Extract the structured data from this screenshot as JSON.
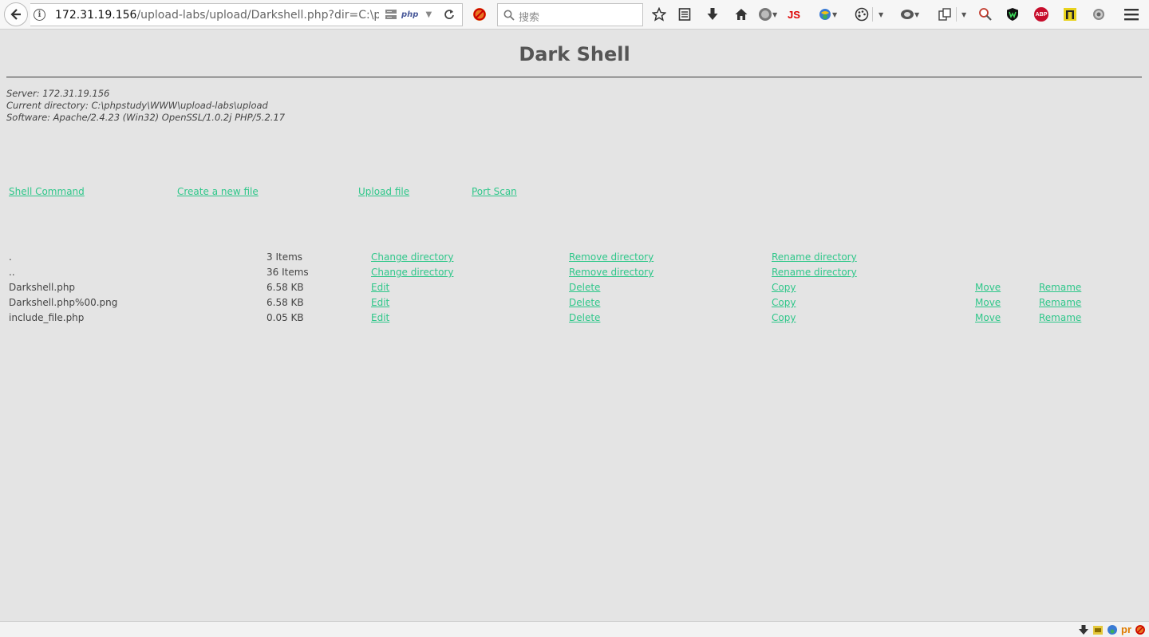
{
  "browser": {
    "url_host": "172.31.19.156",
    "url_path": "/upload-labs/upload/Darkshell.php?dir=C:\\phpstudy\\WWW\\upload-labs\\upload",
    "php_badge": "php",
    "search_placeholder": "搜索",
    "js_ext_label": "JS",
    "abp_label": "ABP"
  },
  "page": {
    "title": "Dark Shell",
    "server_line": "Server: 172.31.19.156",
    "directory_line": "Current directory: C:\\phpstudy\\WWW\\upload-labs\\upload",
    "software_line": "Software: Apache/2.4.23 (Win32) OpenSSL/1.0.2j PHP/5.2.17"
  },
  "nav": [
    {
      "label": "Shell Command"
    },
    {
      "label": "Create a new file"
    },
    {
      "label": "Upload file"
    },
    {
      "label": "Port Scan"
    }
  ],
  "files": [
    {
      "name": ".",
      "size": "3 Items",
      "actions": [
        "Change directory",
        "Remove directory",
        "Rename directory"
      ]
    },
    {
      "name": "..",
      "size": "36 Items",
      "actions": [
        "Change directory",
        "Remove directory",
        "Rename directory"
      ]
    },
    {
      "name": "Darkshell.php",
      "size": "6.58 KB",
      "actions": [
        "Edit",
        "Delete",
        "Copy",
        "Move",
        "Remame"
      ]
    },
    {
      "name": "Darkshell.php%00.png",
      "size": "6.58 KB",
      "actions": [
        "Edit",
        "Delete",
        "Copy",
        "Move",
        "Remame"
      ]
    },
    {
      "name": "include_file.php",
      "size": "0.05 KB",
      "actions": [
        "Edit",
        "Delete",
        "Copy",
        "Move",
        "Remame"
      ]
    }
  ],
  "colors": {
    "link": "#2fc78a",
    "background": "#e4e4e4",
    "text": "#444444"
  }
}
